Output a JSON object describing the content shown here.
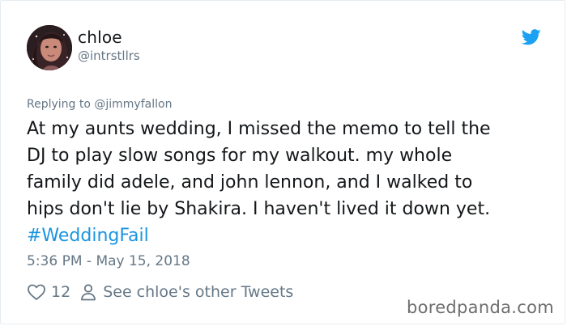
{
  "user": {
    "display_name": "chloe",
    "handle": "@intrstllrs"
  },
  "reply": {
    "text": "Replying to @jimmyfallon"
  },
  "tweet": {
    "body": "At my aunts wedding, I missed the memo to tell the\nDJ to play slow songs for my walkout. my whole\nfamily did adele, and john lennon, and I walked to\nhips don't lie by Shakira. I haven't lived it down yet.",
    "hashtag": "#WeddingFail",
    "timestamp": "5:36 PM - May 15, 2018"
  },
  "actions": {
    "like_count": "12",
    "other_tweets_label": "See chloe's other Tweets"
  },
  "watermark": {
    "text": "boredpanda.com"
  },
  "icons": {
    "brand": "twitter-bird-icon",
    "like": "heart-icon",
    "profile": "person-icon"
  },
  "colors": {
    "twitter_blue": "#1da1f2",
    "link_blue": "#1b95e0",
    "secondary_text": "#657786",
    "primary_text": "#14171a"
  }
}
